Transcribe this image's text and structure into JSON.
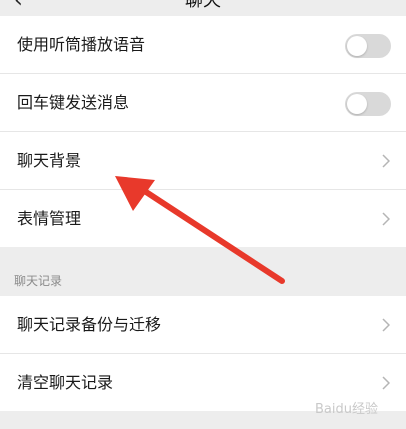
{
  "header": {
    "back_icon": "chevron-left-icon",
    "title": "聊天"
  },
  "settings": [
    {
      "label": "使用听筒播放语音",
      "type": "toggle",
      "on": false
    },
    {
      "label": "回车键发送消息",
      "type": "toggle",
      "on": false
    },
    {
      "label": "聊天背景",
      "type": "link",
      "icon": "chevron-right-icon"
    },
    {
      "label": "表情管理",
      "type": "link",
      "icon": "chevron-right-icon"
    }
  ],
  "section_title": "聊天记录",
  "history": [
    {
      "label": "聊天记录备份与迁移",
      "icon": "chevron-right-icon"
    },
    {
      "label": "清空聊天记录",
      "icon": "chevron-right-icon"
    }
  ],
  "annotation": {
    "color": "#e8392b",
    "points_to": "聊天背景"
  },
  "watermark": "Baidu经验"
}
